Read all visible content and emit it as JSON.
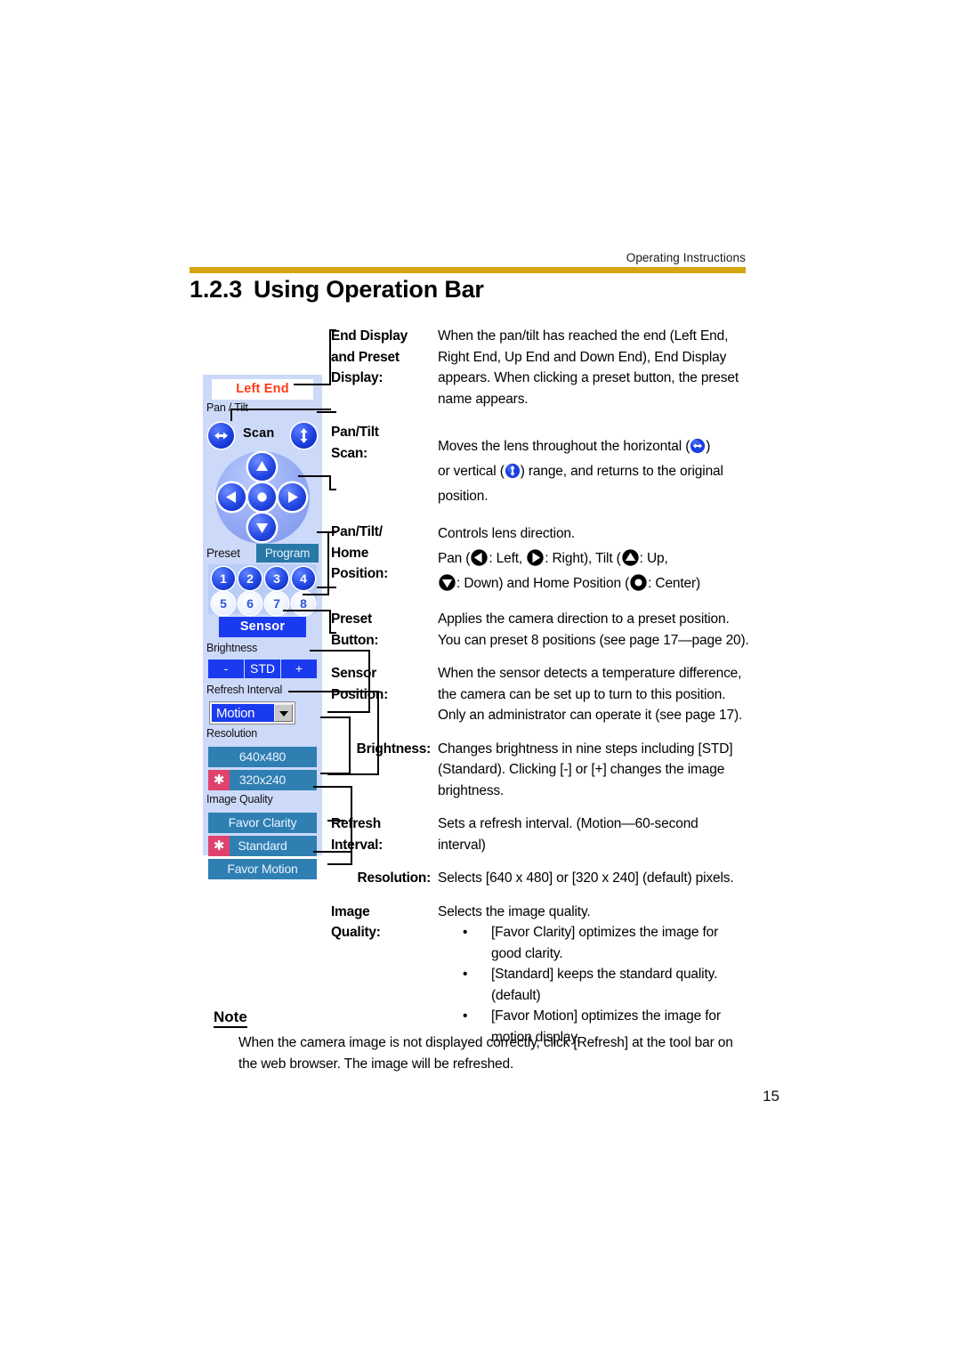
{
  "header": {
    "running_head": "Operating Instructions",
    "rule_color": "#d6a610"
  },
  "section": {
    "number": "1.2.3",
    "title": "Using Operation Bar"
  },
  "operation_bar": {
    "end_display": {
      "value": "Left End",
      "text_color": "#ff3a17",
      "background": "#ffffff"
    },
    "pan_tilt_label": "Pan / Tilt",
    "scan": {
      "word": "Scan",
      "horizontal_icon": "horizontal-scan-icon",
      "vertical_icon": "vertical-scan-icon"
    },
    "dpad": {
      "up_icon": "arrow-up-icon",
      "down_icon": "arrow-down-icon",
      "left_icon": "arrow-left-icon",
      "right_icon": "arrow-right-icon",
      "center_icon": "home-center-icon"
    },
    "preset": {
      "label": "Preset",
      "program_button": "Program",
      "buttons": [
        {
          "num": "1",
          "state": "on"
        },
        {
          "num": "2",
          "state": "on"
        },
        {
          "num": "3",
          "state": "on"
        },
        {
          "num": "4",
          "state": "on"
        },
        {
          "num": "5",
          "state": "off"
        },
        {
          "num": "6",
          "state": "off"
        },
        {
          "num": "7",
          "state": "off"
        },
        {
          "num": "8",
          "state": "off"
        }
      ]
    },
    "sensor_button": "Sensor",
    "brightness": {
      "label": "Brightness",
      "minus": "-",
      "std": "STD",
      "plus": "+"
    },
    "refresh_interval": {
      "label": "Refresh Interval",
      "selected": "Motion"
    },
    "resolution": {
      "label": "Resolution",
      "options": [
        {
          "text": "640x480",
          "selected": false
        },
        {
          "text": "320x240",
          "selected": true
        }
      ]
    },
    "image_quality": {
      "label": "Image Quality",
      "options": [
        {
          "text": "Favor Clarity",
          "selected": false
        },
        {
          "text": "Standard",
          "selected": true
        },
        {
          "text": "Favor Motion",
          "selected": false
        }
      ]
    },
    "colors": {
      "panel": "#ccd9f9",
      "primary_blue": "#1a3af0",
      "steel_blue": "#2f7fb2",
      "program_blue": "#2878a8",
      "selected_marker": "#e0426e"
    }
  },
  "definitions": [
    {
      "term_lines": [
        "End Display",
        "and Preset",
        "Display:"
      ],
      "desc": "When the pan/tilt has reached the end (Left End, Right End, Up End and Down End), End Display appears. When clicking a preset button, the preset name appears."
    },
    {
      "term_lines": [
        "Pan/Tilt",
        "Scan:"
      ],
      "desc_line_1_a": "Moves the lens throughout the horizontal (",
      "desc_line_1_b": ")",
      "desc_line_2_a": "or vertical (",
      "desc_line_2_b": ") range, and returns to the original position."
    },
    {
      "term_lines": [
        "Pan/Tilt/",
        "Home",
        "Position:"
      ],
      "desc_line_1": "Controls lens direction.",
      "desc_line_2_a": "Pan (",
      "desc_line_2_b": ": Left, ",
      "desc_line_2_c": ": Right), Tilt (",
      "desc_line_2_d": ": Up,",
      "desc_line_3_a": ": Down) and Home Position (",
      "desc_line_3_b": ": Center)"
    },
    {
      "term_lines": [
        "Preset",
        "Button:"
      ],
      "desc": "Applies the camera direction to a preset position. You can preset 8 positions (see page 17—page 20)."
    },
    {
      "term_lines": [
        "Sensor",
        "Position:"
      ],
      "desc": "When the sensor detects a temperature difference, the camera can be set up to turn to this position. Only an administrator can operate it (see page 17)."
    },
    {
      "term_lines": [
        "Brightness:"
      ],
      "desc": "Changes brightness in nine steps including [STD] (Standard). Clicking [-] or [+] changes the image brightness."
    },
    {
      "term_lines": [
        "Refresh",
        "Interval:"
      ],
      "desc": "Sets a refresh interval. (Motion—60-second interval)"
    },
    {
      "term_lines": [
        "Resolution:"
      ],
      "desc": "Selects [640 x 480] or [320 x 240] (default) pixels."
    },
    {
      "term_lines": [
        "Image",
        "Quality:"
      ],
      "desc": "Selects the image quality.",
      "bullets": [
        "[Favor Clarity] optimizes the image for good clarity.",
        "[Standard] keeps the standard quality. (default)",
        "[Favor Motion] optimizes the image for motion display."
      ]
    }
  ],
  "note": {
    "heading": "Note",
    "body": "When the camera image is not displayed correctly, click [Refresh] at the tool bar on the web browser. The image will be refreshed."
  },
  "folio": "15"
}
